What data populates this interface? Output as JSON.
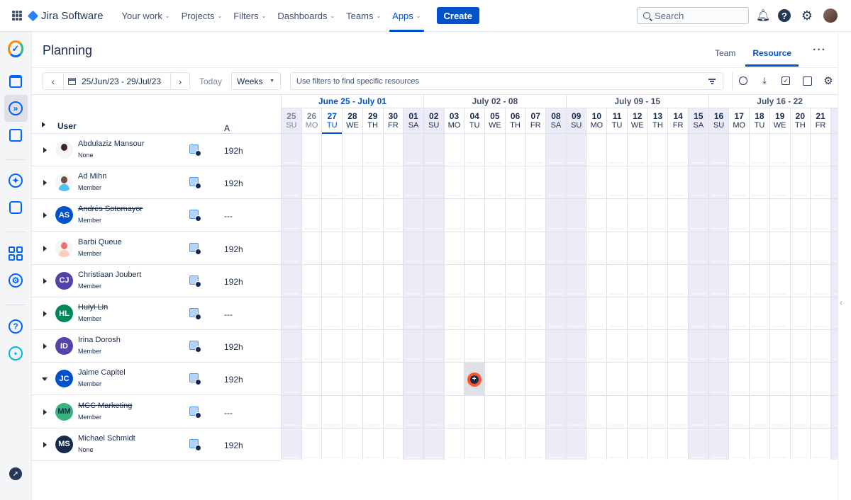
{
  "app": {
    "name": "Jira Software"
  },
  "nav": {
    "items": [
      {
        "label": "Your work",
        "active": false
      },
      {
        "label": "Projects",
        "active": false
      },
      {
        "label": "Filters",
        "active": false
      },
      {
        "label": "Dashboards",
        "active": false
      },
      {
        "label": "Teams",
        "active": false
      },
      {
        "label": "Apps",
        "active": true
      }
    ],
    "create_label": "Create",
    "search_placeholder": "Search"
  },
  "page": {
    "title": "Planning",
    "tabs": [
      {
        "label": "Team",
        "active": false
      },
      {
        "label": "Resource",
        "active": true
      }
    ]
  },
  "toolbar": {
    "date_range": "25/Jun/23 - 29/Jul/23",
    "today_label": "Today",
    "view_select": "Weeks",
    "filter_placeholder": "Use filters to find specific resources"
  },
  "table": {
    "user_header": "User",
    "a_header": "A",
    "rows": [
      {
        "name": "Abdulaziz Mansour",
        "role": "None",
        "hours": "192h",
        "avatar": "photo-woman",
        "initials": "",
        "strike": false,
        "expanded": false
      },
      {
        "name": "Ad Mihn",
        "role": "Member",
        "hours": "192h",
        "avatar": "photo-man",
        "initials": "",
        "strike": false,
        "expanded": false
      },
      {
        "name": "Andrés Sotomayor",
        "role": "Member",
        "hours": "---",
        "avatar": "initials",
        "initials": "AS",
        "color": "#0052cc",
        "strike": true,
        "expanded": false
      },
      {
        "name": "Barbi Queue",
        "role": "Member",
        "hours": "192h",
        "avatar": "photo-redhead",
        "initials": "",
        "strike": false,
        "expanded": false
      },
      {
        "name": "Christiaan Joubert",
        "role": "Member",
        "hours": "192h",
        "avatar": "initials",
        "initials": "CJ",
        "color": "#5243aa",
        "strike": false,
        "expanded": false
      },
      {
        "name": "Huiyi Lin",
        "role": "Member",
        "hours": "---",
        "avatar": "initials",
        "initials": "HL",
        "color": "#00875a",
        "strike": true,
        "expanded": false
      },
      {
        "name": "Irina Dorosh",
        "role": "Member",
        "hours": "192h",
        "avatar": "initials",
        "initials": "ID",
        "color": "#5243aa",
        "strike": false,
        "expanded": false
      },
      {
        "name": "Jaime Capitel",
        "role": "Member",
        "hours": "192h",
        "avatar": "initials",
        "initials": "JC",
        "color": "#0052cc",
        "strike": false,
        "expanded": true
      },
      {
        "name": "MCC Marketing",
        "role": "Member",
        "hours": "---",
        "avatar": "initials",
        "initials": "MM",
        "color": "#36b37e",
        "text_color": "#172b4d",
        "strike": true,
        "expanded": false
      },
      {
        "name": "Michael Schmidt",
        "role": "None",
        "hours": "192h",
        "avatar": "initials",
        "initials": "MS",
        "color": "#172b4d",
        "strike": false,
        "expanded": false
      }
    ]
  },
  "calendar": {
    "weeks": [
      {
        "label": "June 25 - July 01",
        "current": true
      },
      {
        "label": "July 02 - 08",
        "current": false
      },
      {
        "label": "July 09 - 15",
        "current": false
      },
      {
        "label": "July 16 - 22",
        "current": false
      }
    ],
    "days": [
      {
        "num": "25",
        "dow": "SU",
        "state": "past"
      },
      {
        "num": "26",
        "dow": "MO",
        "state": "past"
      },
      {
        "num": "27",
        "dow": "TU",
        "state": "today"
      },
      {
        "num": "28",
        "dow": "WE",
        "state": ""
      },
      {
        "num": "29",
        "dow": "TH",
        "state": ""
      },
      {
        "num": "30",
        "dow": "FR",
        "state": ""
      },
      {
        "num": "01",
        "dow": "SA",
        "state": ""
      },
      {
        "num": "02",
        "dow": "SU",
        "state": ""
      },
      {
        "num": "03",
        "dow": "MO",
        "state": ""
      },
      {
        "num": "04",
        "dow": "TU",
        "state": ""
      },
      {
        "num": "05",
        "dow": "WE",
        "state": ""
      },
      {
        "num": "06",
        "dow": "TH",
        "state": ""
      },
      {
        "num": "07",
        "dow": "FR",
        "state": ""
      },
      {
        "num": "08",
        "dow": "SA",
        "state": ""
      },
      {
        "num": "09",
        "dow": "SU",
        "state": ""
      },
      {
        "num": "10",
        "dow": "MO",
        "state": ""
      },
      {
        "num": "11",
        "dow": "TU",
        "state": ""
      },
      {
        "num": "12",
        "dow": "WE",
        "state": ""
      },
      {
        "num": "13",
        "dow": "TH",
        "state": ""
      },
      {
        "num": "14",
        "dow": "FR",
        "state": ""
      },
      {
        "num": "15",
        "dow": "SA",
        "state": ""
      },
      {
        "num": "16",
        "dow": "SU",
        "state": ""
      },
      {
        "num": "17",
        "dow": "MO",
        "state": ""
      },
      {
        "num": "18",
        "dow": "TU",
        "state": ""
      },
      {
        "num": "19",
        "dow": "WE",
        "state": ""
      },
      {
        "num": "20",
        "dow": "TH",
        "state": ""
      },
      {
        "num": "21",
        "dow": "FR",
        "state": ""
      },
      {
        "num": "2",
        "dow": "S",
        "state": ""
      }
    ],
    "add_marker": {
      "row": 7,
      "day": "04",
      "icon": "plus-circle-icon"
    }
  },
  "colors": {
    "brand": "#0052cc",
    "weekend": "#ebecf7",
    "add_marker": "#ff5630"
  }
}
